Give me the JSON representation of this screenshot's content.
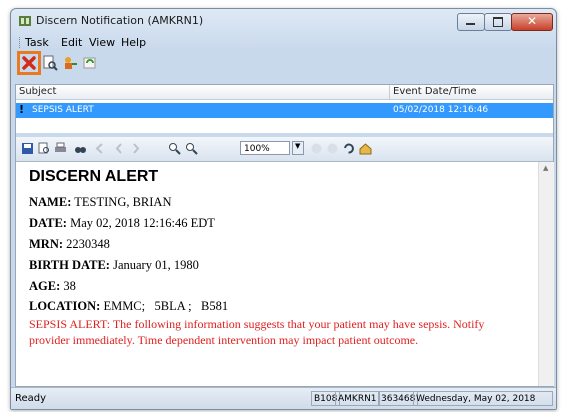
{
  "window": {
    "title": "Discern Notification (AMKRN1)"
  },
  "menu": {
    "items": [
      "Task",
      "Edit",
      "View",
      "Help"
    ]
  },
  "list": {
    "columns": [
      "Subject",
      "Event Date/Time"
    ],
    "rows": [
      {
        "flag": "!",
        "subject": "SEPSIS ALERT",
        "datetime": "05/02/2018 12:16:46"
      }
    ]
  },
  "viewer_toolbar": {
    "zoom": "100%"
  },
  "document": {
    "heading": "DISCERN ALERT",
    "fields": [
      {
        "label": "NAME:",
        "value": "TESTING, BRIAN"
      },
      {
        "label": "DATE:",
        "value": "May 02, 2018 12:16:46 EDT"
      },
      {
        "label": "MRN:",
        "value": "2230348"
      },
      {
        "label": "BIRTH DATE:",
        "value": "January 01, 1980"
      },
      {
        "label": "AGE:",
        "value": "38"
      },
      {
        "label": "LOCATION:",
        "value": "EMMC;   5BLA ;   B581"
      }
    ],
    "alert_text": "SEPSIS ALERT: The following information suggests that your patient may have sepsis. Notify provider immediately. Time dependent intervention may impact patient outcome.",
    "alert_color": "#e02020"
  },
  "status": {
    "text": "Ready",
    "panels": [
      "B108",
      "AMKRN1",
      "363468",
      "Wednesday, May 02, 2018"
    ]
  },
  "accent": {
    "selection": "#3399ff",
    "highlight_box": "#e87a22"
  }
}
